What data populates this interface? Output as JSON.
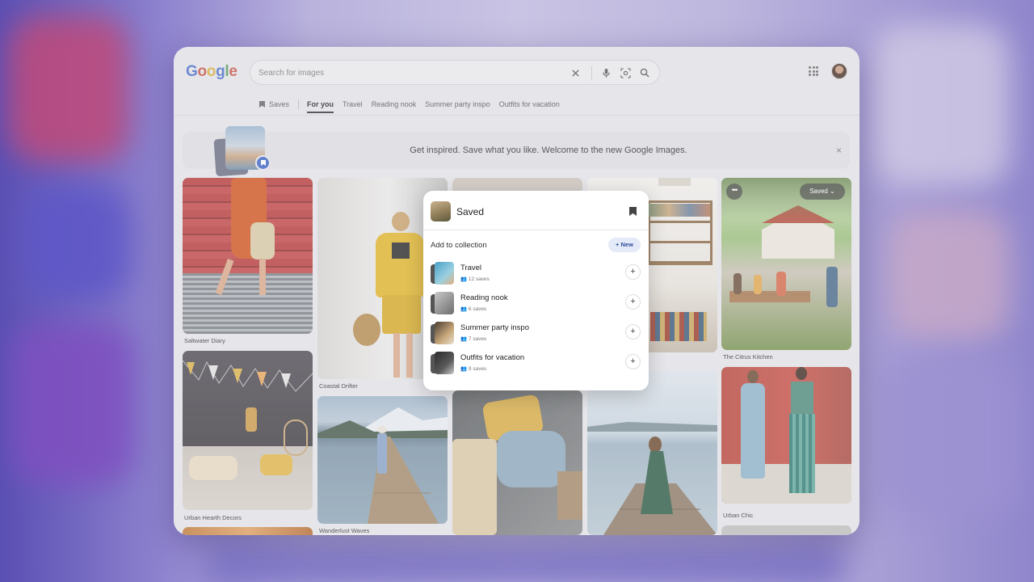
{
  "header": {
    "logo": [
      "G",
      "o",
      "o",
      "g",
      "l",
      "e"
    ],
    "search_placeholder": "Search for images",
    "icons": {
      "clear": "close-icon",
      "voice": "microphone-icon",
      "lens": "camera-lens-icon",
      "search": "search-icon",
      "apps": "apps-grid-icon"
    }
  },
  "tabs": {
    "saves": "Saves",
    "items": [
      "For you",
      "Travel",
      "Reading nook",
      "Summer party inspo",
      "Outfits for vacation"
    ],
    "active": "For you"
  },
  "banner": {
    "text": "Get inspired. Save what you like. Welcome to the new Google Images.",
    "close": "×"
  },
  "cards": {
    "c1": "Saltwater Diary",
    "c2": "Coastal Drifter",
    "c3": "The Citrus Kitchen",
    "c4": "Urban Hearth Decors",
    "c5": "Wanderlust Waves",
    "c6": "Urban Chic",
    "saved_pill": "Saved ⌄",
    "more_pill": "•••"
  },
  "popup": {
    "title": "Saved",
    "subtitle": "Add to collection",
    "new_button": "+ New",
    "collections": [
      {
        "name": "Travel",
        "count": "12 saves",
        "color": "#4aa0c8"
      },
      {
        "name": "Reading nook",
        "count": "6 saves",
        "color": "#8a8a8a"
      },
      {
        "name": "Summer party inspo",
        "count": "7 saves",
        "color": "#9b8672"
      },
      {
        "name": "Outfits for vacation",
        "count": "9 saves",
        "color": "#3c3c3c"
      }
    ]
  },
  "colors": {
    "accent": "#3b64c4",
    "window_bg": "#e6e6ea"
  }
}
